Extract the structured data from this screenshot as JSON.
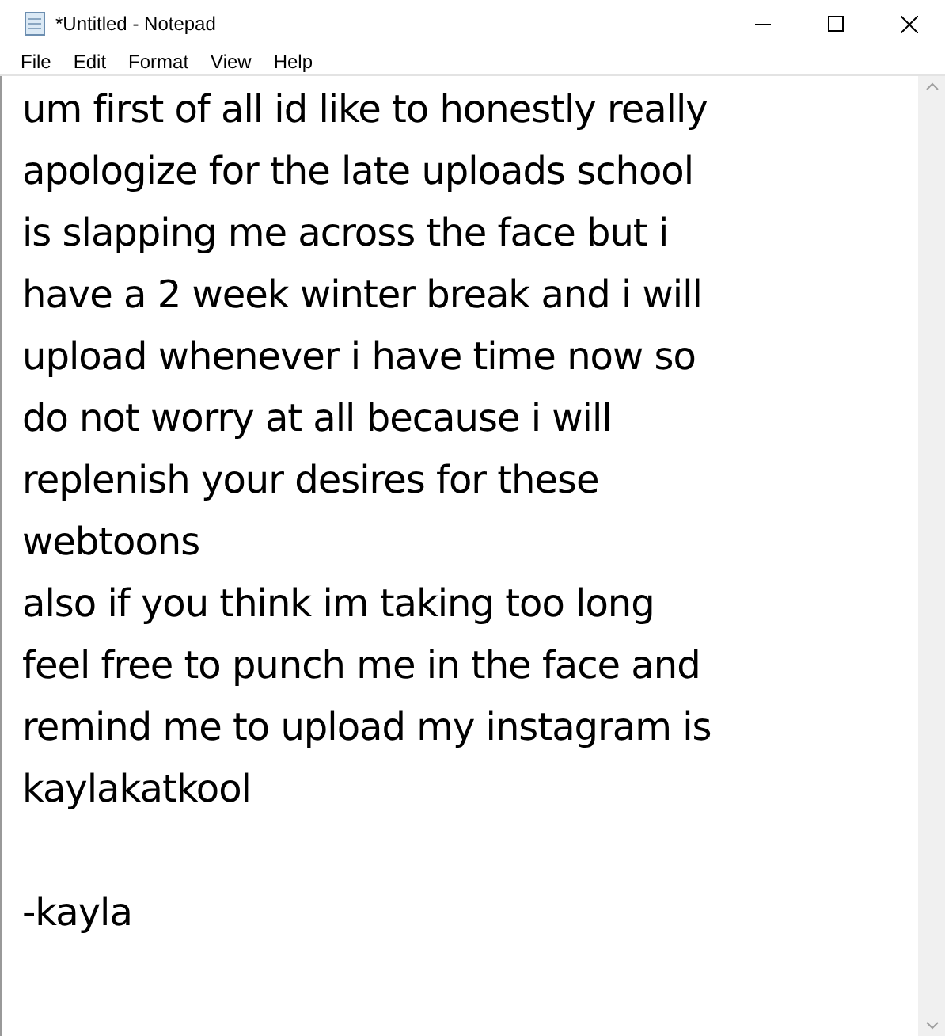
{
  "window": {
    "title": "*Untitled - Notepad"
  },
  "menu": [
    "File",
    "Edit",
    "Format",
    "View",
    "Help"
  ],
  "document": {
    "lines": [
      "um first of all id like to honestly really",
      "apologize for the late uploads school",
      "is slapping me across the face but i",
      "have a 2 week winter break and i will",
      "upload whenever i have time now so",
      "do not worry at all because i will",
      "replenish your desires for these",
      "webtoons",
      "also if you think im taking too long",
      "feel free to punch me in the face and",
      "remind me to upload my instagram is",
      "kaylakatkool"
    ],
    "signature": "-kayla"
  }
}
